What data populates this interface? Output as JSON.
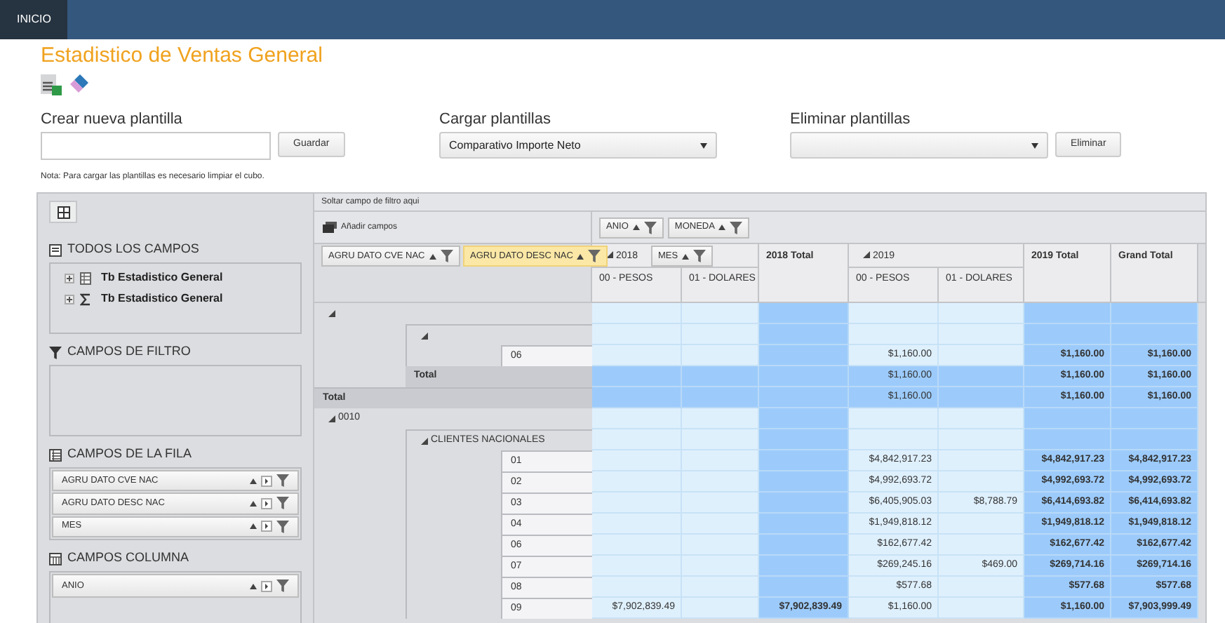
{
  "nav": {
    "tabs": [
      {
        "label": "INICIO",
        "selected": true
      }
    ]
  },
  "title": "Estadistico de Ventas General",
  "templates": [
    {
      "kind": "input",
      "label": "Crear nueva plantilla",
      "button": "Guardar"
    },
    {
      "kind": "select",
      "label": "Cargar plantillas",
      "value": "Comparativo Importe Neto"
    },
    {
      "kind": "select",
      "label": "Eliminar plantillas",
      "button": "Eliminar"
    }
  ],
  "note": "Nota: Para cargar las plantillas es necesario limpiar el cubo.",
  "field_list": {
    "sections": [
      {
        "kind": "tree",
        "title": "TODOS LOS CAMPOS",
        "items": [
          {
            "kind": "dimension",
            "label": "Tb Estadistico General",
            "expanded": false
          },
          {
            "kind": "measure",
            "label": "Tb Estadistico General",
            "expanded": false
          }
        ]
      },
      {
        "kind": "filter",
        "title": "CAMPOS DE FILTRO"
      },
      {
        "kind": "rows",
        "title": "CAMPOS DE LA FILA",
        "items": [
          {
            "label": "AGRU DATO CVE NAC"
          },
          {
            "label": "AGRU DATO DESC NAC"
          },
          {
            "label": "MES"
          }
        ]
      },
      {
        "kind": "columns",
        "title": "CAMPOS COLUMNA",
        "items": [
          {
            "label": "ANIO"
          }
        ]
      }
    ]
  },
  "pivot": {
    "filter_area": "Soltar campo de filtro aqui",
    "add_fields": "Añadir campos",
    "column_fields": [
      {
        "label": "ANIO"
      },
      {
        "label": "MONEDA"
      }
    ],
    "row_fields": [
      {
        "label": "AGRU DATO CVE NAC",
        "selected": false
      },
      {
        "label": "AGRU DATO DESC NAC",
        "selected": true
      },
      {
        "label": "MES",
        "selected": false
      }
    ],
    "column_groups": [
      {
        "kind": "year",
        "label": "2018",
        "expanded": true,
        "columns": [
          "00 - PESOS",
          "01 - DOLARES"
        ]
      },
      {
        "kind": "total",
        "label": "2018 Total"
      },
      {
        "kind": "year",
        "label": "2019",
        "expanded": true,
        "columns": [
          "00 - PESOS",
          "01 - DOLARES"
        ]
      },
      {
        "kind": "total",
        "label": "2019 Total"
      },
      {
        "kind": "total",
        "label": "Grand Total"
      }
    ],
    "rows": [
      {
        "kind": "group",
        "expanded": true,
        "cells": [
          null,
          null,
          null,
          null,
          null,
          null,
          null
        ]
      },
      {
        "kind": "subgroup",
        "expanded": true,
        "cells": [
          null,
          null,
          null,
          null,
          null,
          null,
          null
        ]
      },
      {
        "kind": "leaf",
        "label": "06",
        "cells": [
          null,
          null,
          null,
          "$1,160.00",
          null,
          "$1,160.00",
          "$1,160.00"
        ]
      },
      {
        "kind": "subtotal",
        "label": "Total",
        "cells": [
          null,
          null,
          null,
          "$1,160.00",
          null,
          "$1,160.00",
          "$1,160.00"
        ]
      },
      {
        "kind": "total",
        "label": "Total",
        "cells": [
          null,
          null,
          null,
          "$1,160.00",
          null,
          "$1,160.00",
          "$1,160.00"
        ]
      },
      {
        "kind": "group",
        "label": "0010",
        "expanded": true,
        "cells": [
          null,
          null,
          null,
          null,
          null,
          null,
          null
        ]
      },
      {
        "kind": "subgroup",
        "label": "CLIENTES NACIONALES",
        "expanded": true,
        "cells": [
          null,
          null,
          null,
          null,
          null,
          null,
          null
        ]
      },
      {
        "kind": "leaf",
        "label": "01",
        "cells": [
          null,
          null,
          null,
          "$4,842,917.23",
          null,
          "$4,842,917.23",
          "$4,842,917.23"
        ]
      },
      {
        "kind": "leaf",
        "label": "02",
        "cells": [
          null,
          null,
          null,
          "$4,992,693.72",
          null,
          "$4,992,693.72",
          "$4,992,693.72"
        ]
      },
      {
        "kind": "leaf",
        "label": "03",
        "cells": [
          null,
          null,
          null,
          "$6,405,905.03",
          "$8,788.79",
          "$6,414,693.82",
          "$6,414,693.82"
        ]
      },
      {
        "kind": "leaf",
        "label": "04",
        "cells": [
          null,
          null,
          null,
          "$1,949,818.12",
          null,
          "$1,949,818.12",
          "$1,949,818.12"
        ]
      },
      {
        "kind": "leaf",
        "label": "06",
        "cells": [
          null,
          null,
          null,
          "$162,677.42",
          null,
          "$162,677.42",
          "$162,677.42"
        ]
      },
      {
        "kind": "leaf",
        "label": "07",
        "cells": [
          null,
          null,
          null,
          "$269,245.16",
          "$469.00",
          "$269,714.16",
          "$269,714.16"
        ]
      },
      {
        "kind": "leaf",
        "label": "08",
        "cells": [
          null,
          null,
          null,
          "$577.68",
          null,
          "$577.68",
          "$577.68"
        ]
      },
      {
        "kind": "leaf",
        "label": "09",
        "cells": [
          "$7,902,839.49",
          null,
          "$7,902,839.49",
          "$1,160.00",
          null,
          "$1,160.00",
          "$7,903,999.49"
        ]
      }
    ]
  }
}
